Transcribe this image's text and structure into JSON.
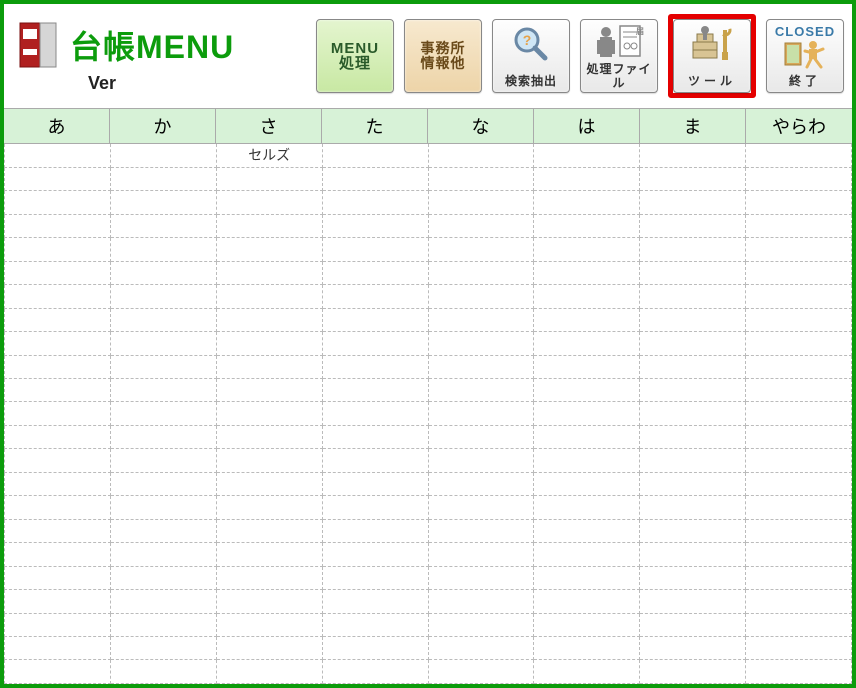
{
  "header": {
    "title": "台帳MENU",
    "version_label": "Ver",
    "version_value": ""
  },
  "toolbar": {
    "menu_process": "MENU\n処理",
    "office_info": "事務所\n情報他",
    "search": "検索抽出",
    "process_file": "処理ファイル",
    "tool": "ツール",
    "closed_label": "CLOSED",
    "exit": "終了"
  },
  "kana_tabs": [
    "あ",
    "か",
    "さ",
    "た",
    "な",
    "は",
    "ま",
    "やらわ"
  ],
  "grid": {
    "columns": 8,
    "rows": 23,
    "cells": {
      "0,2": "セルズ",
      "0,3": "",
      "0,6": "",
      "1,2": ""
    }
  }
}
